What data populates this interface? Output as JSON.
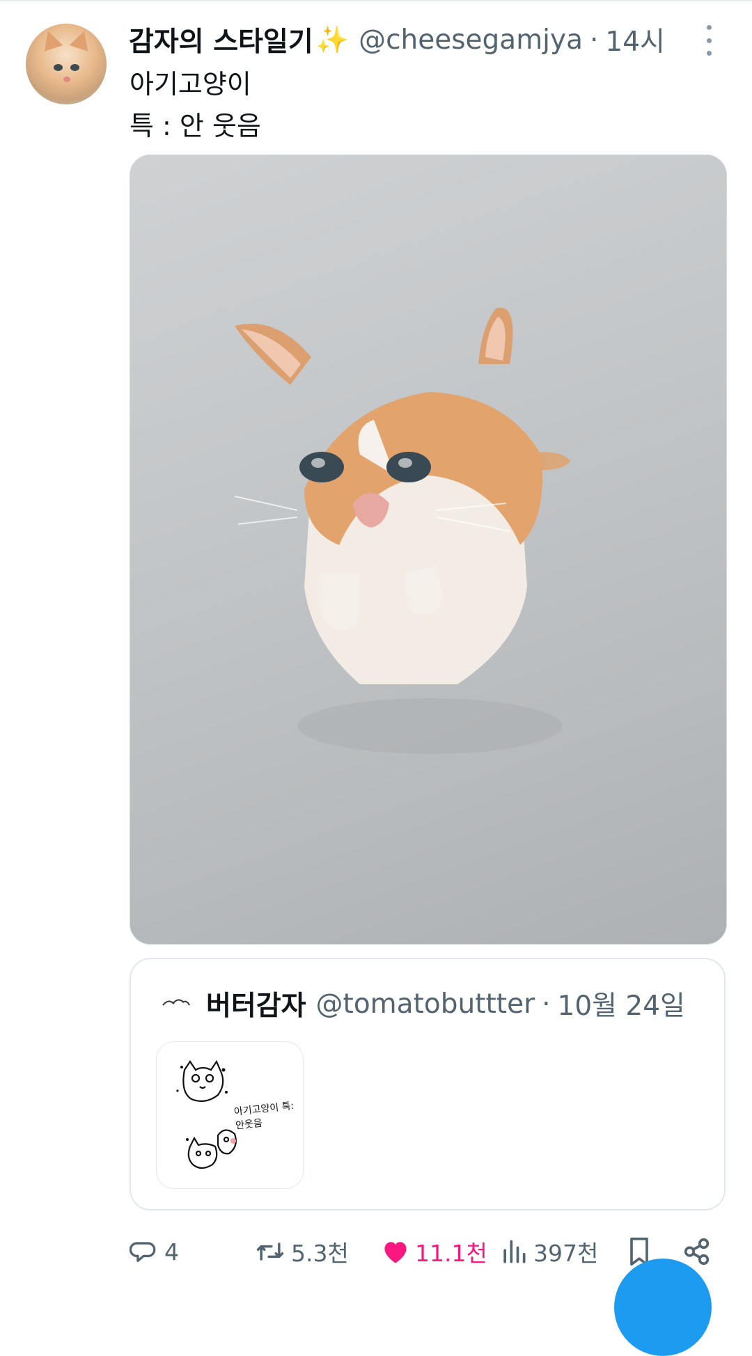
{
  "post": {
    "display_name": "감자의 스타일기",
    "display_emoji": "✨",
    "handle": "@cheesegamjya",
    "separator": "·",
    "time": "14시",
    "text_line1": "아기고양이",
    "text_line2": "특 : 안 웃음",
    "avatar_icon": "kitten-avatar",
    "more_icon": "more-vertical-icon"
  },
  "quote": {
    "display_name": "버터감자",
    "handle": "@tomatobuttter",
    "separator": "·",
    "time": "10월 24일",
    "thumbnail_text": "아기고양이 특: 안웃음"
  },
  "actions": {
    "replies": "4",
    "retweets": "5.3천",
    "likes": "11.1천",
    "views": "397천"
  },
  "colors": {
    "like_pink": "#f91880",
    "secondary_text": "#536471",
    "accent_blue": "#1d9bf0"
  }
}
